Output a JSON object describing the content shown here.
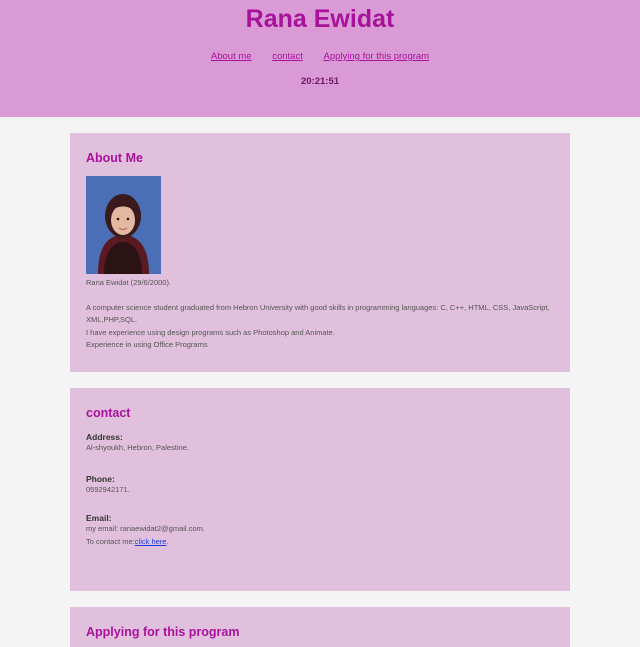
{
  "header": {
    "title": "Rana Ewidat",
    "nav": [
      "About me",
      "contact",
      "Applying for this program"
    ],
    "clock": "20:21:51"
  },
  "about": {
    "heading": "About Me",
    "name_line": "Rana Ewidat (29/6/2000).",
    "bio_1": "A computer science student graduated from Hebron University with good skills in programming languages: C, C++, HTML, CSS, JavaScript, XML,PHP,SQL.",
    "bio_2": "I have experience using design programs such as Photoshop and Animate.",
    "bio_3": "Experience in using Office Programs"
  },
  "contact": {
    "heading": "contact",
    "address_label": "Address:",
    "address_value": "Al-shyoukh, Hebron, Palestine.",
    "phone_label": "Phone:",
    "phone_value": "0592942171.",
    "email_label": "Email:",
    "email_value": "my email: ranaewidat2@gmail.com.",
    "contact_prefix": "To contact me:",
    "contact_link": "click here",
    "contact_suffix": "."
  },
  "apply": {
    "heading": "Applying for this program"
  },
  "colors": {
    "header_bg": "#d99ad6",
    "card_bg": "#e0c0dc",
    "accent": "#a8129a"
  }
}
